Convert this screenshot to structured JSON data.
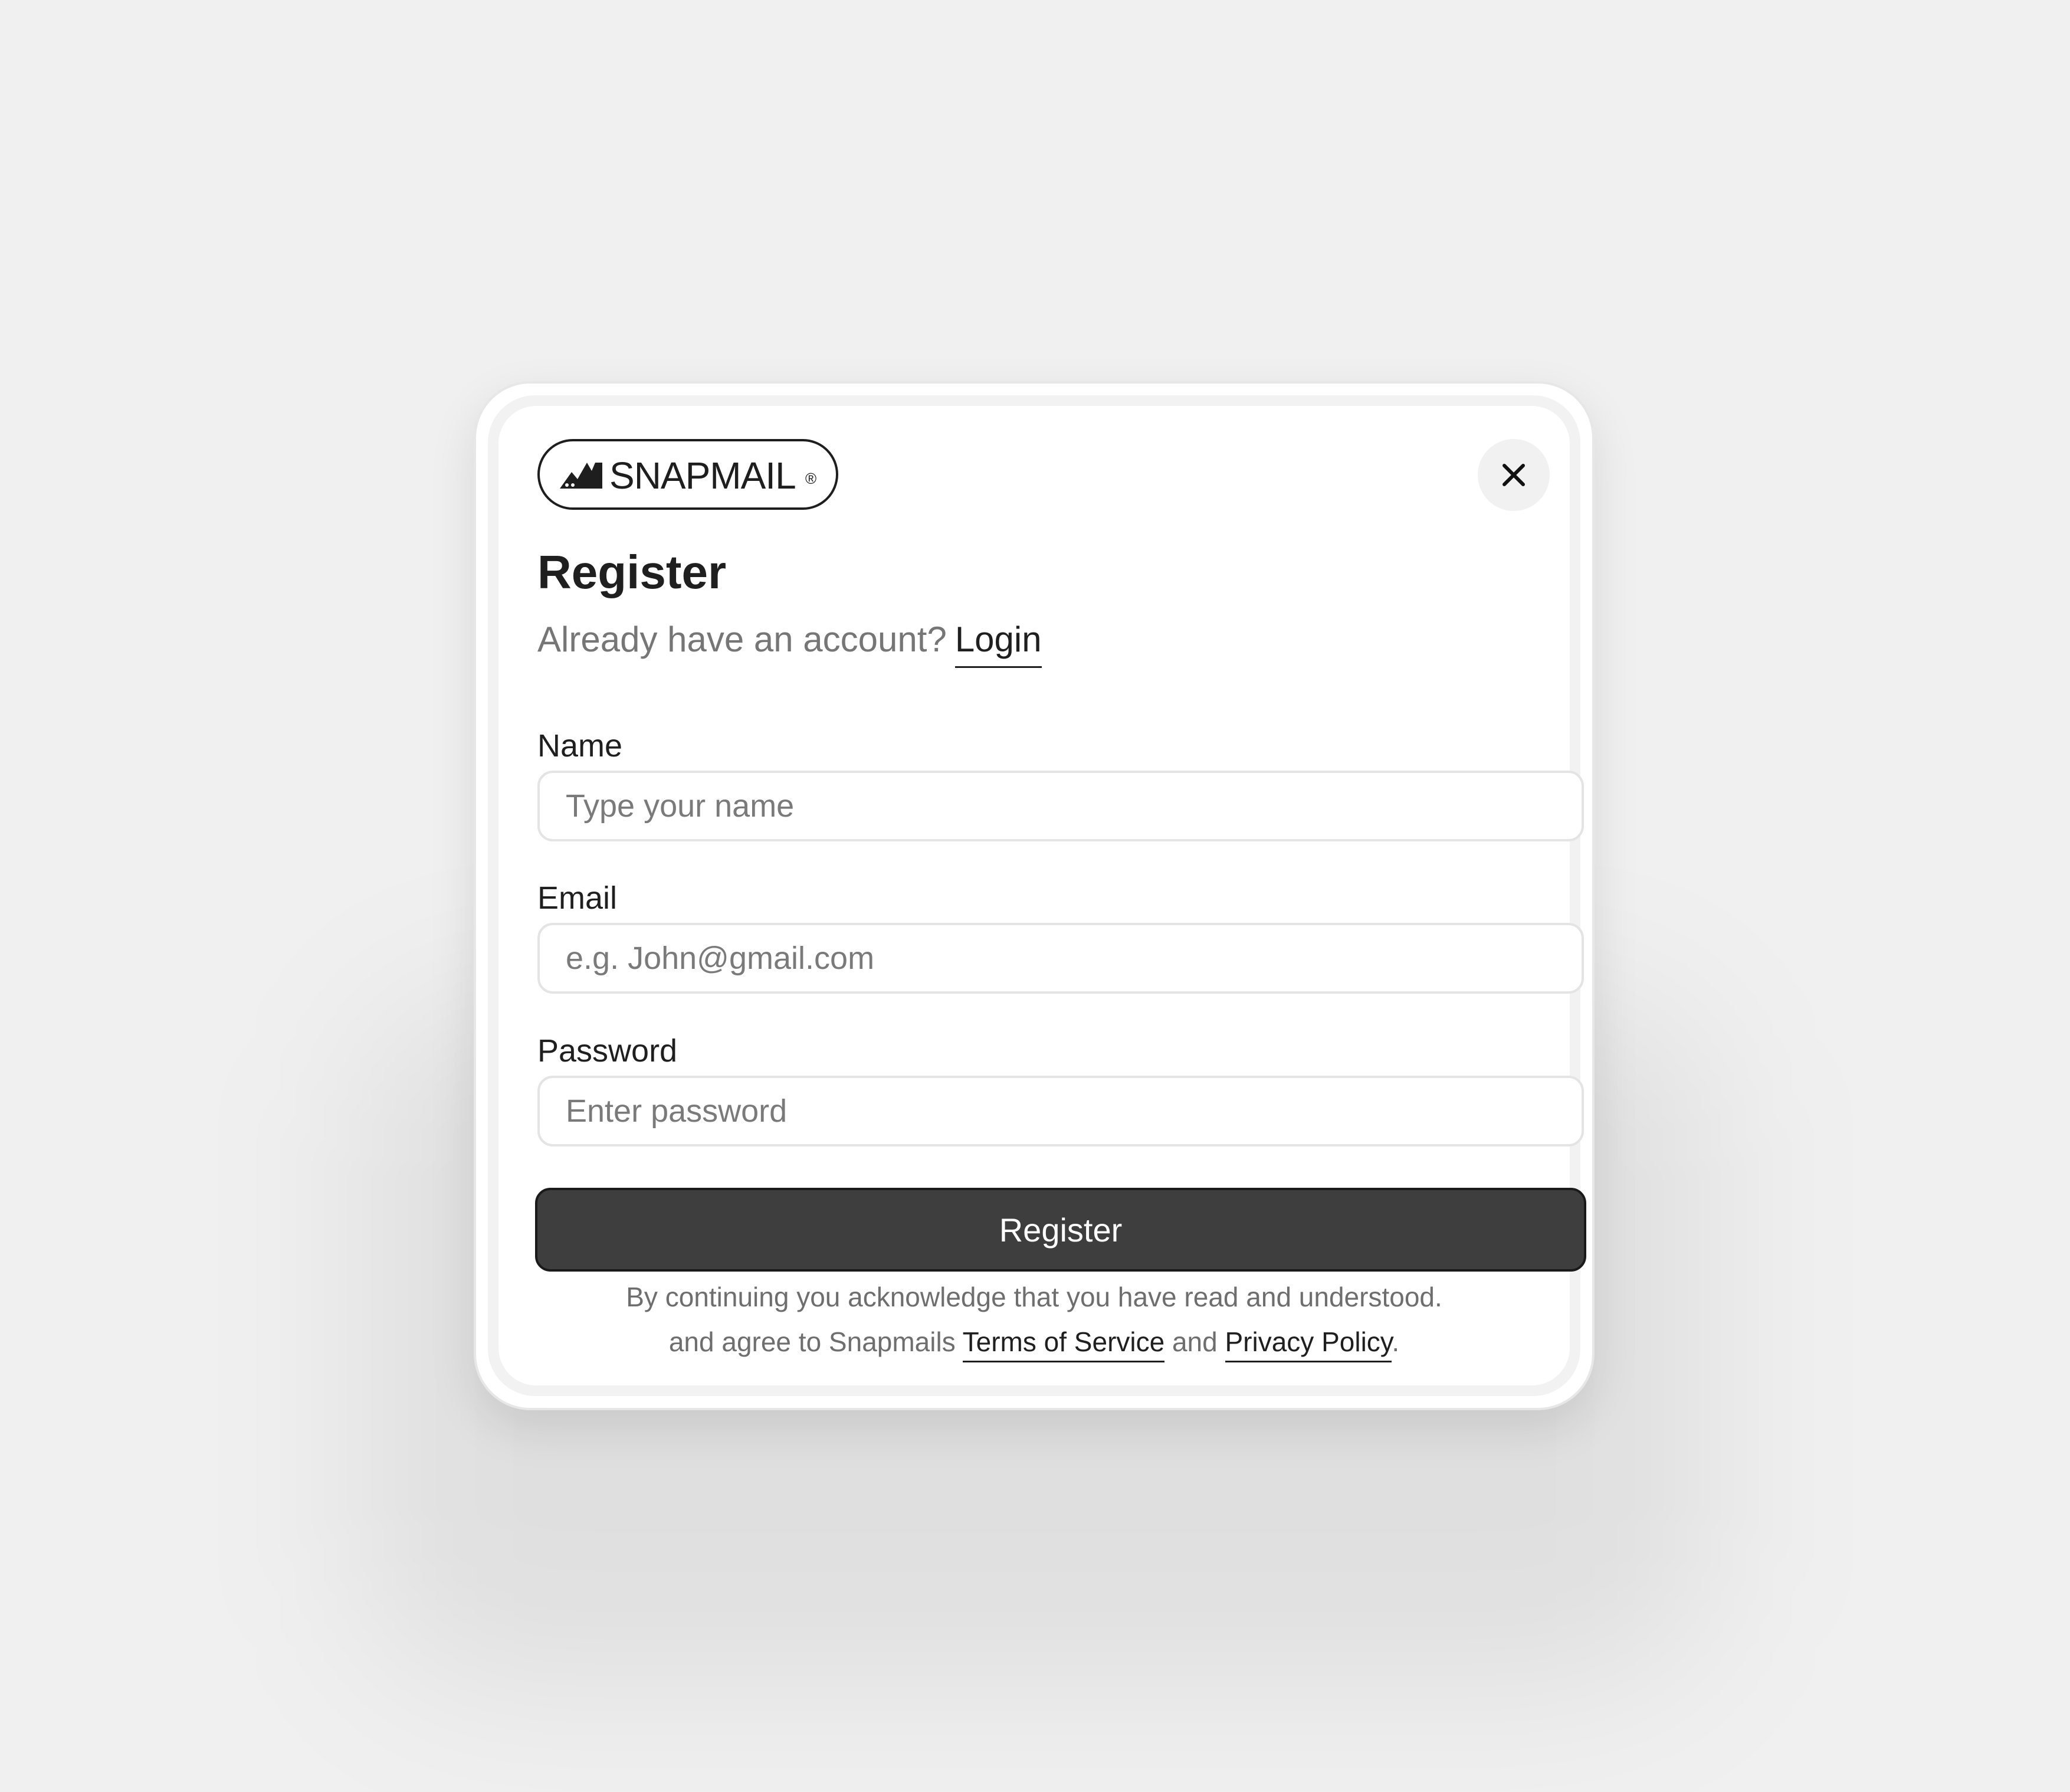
{
  "brand": {
    "name": "SNAPMAIL",
    "registered_mark": "®",
    "logo_icon": "snapmail-mountain-logo"
  },
  "header": {
    "close_icon": "close-icon"
  },
  "form": {
    "title": "Register",
    "subtitle_text": "Already have an account?",
    "login_link": "Login",
    "fields": [
      {
        "label": "Name",
        "placeholder": "Type your name",
        "value": ""
      },
      {
        "label": "Email",
        "placeholder": "e.g. John@gmail.com",
        "value": ""
      },
      {
        "label": "Password",
        "placeholder": "Enter password",
        "value": ""
      }
    ],
    "submit_label": "Register"
  },
  "footer": {
    "line1": "By continuing you acknowledge that you have read and understood.",
    "line2_prefix": "and agree to Snapmails",
    "terms_link": "Terms of Service",
    "conjunction": "and",
    "privacy_link": "Privacy Policy",
    "suffix": "."
  },
  "colors": {
    "background": "#f0f0f0",
    "card": "#ffffff",
    "primary_button": "#3e3e3e",
    "text_primary": "#1f1f1f",
    "text_muted": "#767676"
  }
}
